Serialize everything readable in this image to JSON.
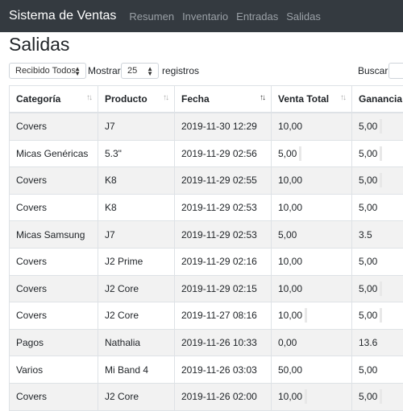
{
  "navbar": {
    "brand": "Sistema de Ventas",
    "links": [
      "Resumen",
      "Inventario",
      "Entradas",
      "Salidas"
    ]
  },
  "page": {
    "title": "Salidas"
  },
  "controls": {
    "filter_selected": "Recibido Todos",
    "show_label": "Mostrar",
    "page_size": "25",
    "records_label": "registros",
    "search_label": "Buscar:"
  },
  "table": {
    "headers": [
      "Categoría",
      "Producto",
      "Fecha",
      "Venta Total",
      "Ganancia"
    ],
    "rows": [
      [
        "Covers",
        "J7",
        "2019-11-30 12:29",
        "10,00",
        "5,00"
      ],
      [
        "Micas Genéricas",
        "5.3\"",
        "2019-11-29 02:56",
        "5,00",
        "5,00"
      ],
      [
        "Covers",
        "K8",
        "2019-11-29 02:55",
        "10,00",
        "5,00"
      ],
      [
        "Covers",
        "K8",
        "2019-11-29 02:53",
        "10,00",
        "5,00"
      ],
      [
        "Micas Samsung",
        "J7",
        "2019-11-29 02:53",
        "5,00",
        "3.5"
      ],
      [
        "Covers",
        "J2 Prime",
        "2019-11-29 02:16",
        "10,00",
        "5,00"
      ],
      [
        "Covers",
        "J2 Core",
        "2019-11-29 02:15",
        "10,00",
        "5,00"
      ],
      [
        "Covers",
        "J2 Core",
        "2019-11-27 08:16",
        "10,00",
        "5,00"
      ],
      [
        "Pagos",
        "Nathalia",
        "2019-11-26 10:33",
        "0,00",
        "13.6"
      ],
      [
        "Varios",
        "Mi Band 4",
        "2019-11-26 03:03",
        "50,00",
        "5,00"
      ],
      [
        "Covers",
        "J2 Core",
        "2019-11-26 02:00",
        "10,00",
        "5,00"
      ]
    ]
  },
  "colors": {
    "navbar_bg": "#343a40",
    "stripe": "#f2f2f2",
    "border": "#dee2e6"
  },
  "icons": {
    "sort": "sort-arrows-icon",
    "sort_active": "sort-desc-icon",
    "dropdown": "chevron-updown-icon"
  }
}
